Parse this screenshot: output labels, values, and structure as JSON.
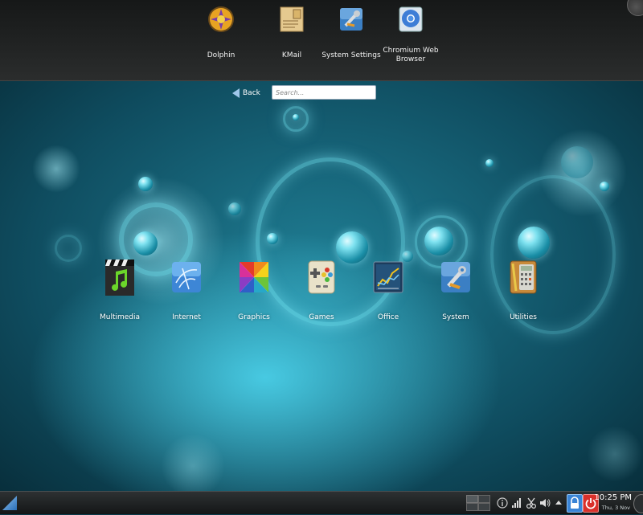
{
  "favorites": [
    {
      "label": "Dolphin",
      "icon": "dolphin-icon"
    },
    {
      "label": "KMail",
      "icon": "kmail-icon"
    },
    {
      "label": "System Settings",
      "icon": "system-settings-icon"
    },
    {
      "label": "Chromium Web Browser",
      "icon": "chromium-icon"
    }
  ],
  "nav": {
    "back_label": "Back",
    "search_placeholder": "Search..."
  },
  "categories": [
    {
      "label": "Multimedia",
      "icon": "multimedia-icon"
    },
    {
      "label": "Internet",
      "icon": "internet-icon"
    },
    {
      "label": "Graphics",
      "icon": "graphics-icon"
    },
    {
      "label": "Games",
      "icon": "games-icon"
    },
    {
      "label": "Office",
      "icon": "office-icon"
    },
    {
      "label": "System",
      "icon": "system-icon"
    },
    {
      "label": "Utilities",
      "icon": "utilities-icon"
    }
  ],
  "taskbar": {
    "time": "10:25 PM",
    "date": "Thu, 3 Nov"
  },
  "colors": {
    "background": "#0f4d60",
    "accent": "#7fe2f0",
    "power": "#d9302b",
    "lock": "#3a84d6"
  }
}
